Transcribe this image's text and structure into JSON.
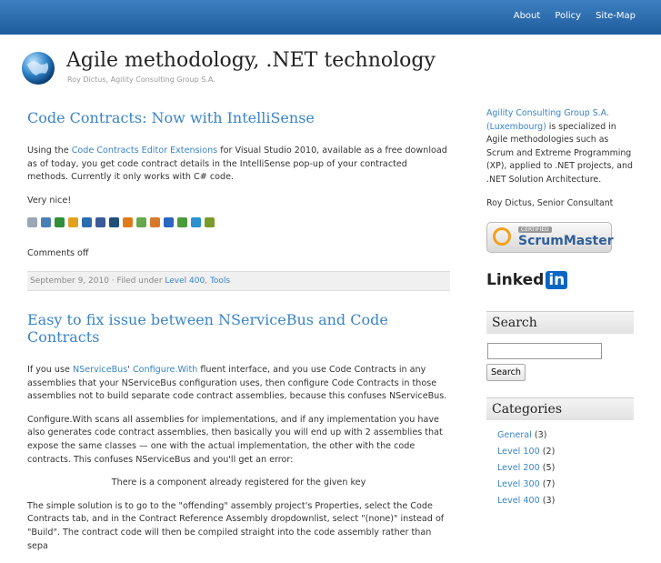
{
  "nav": [
    "About",
    "Policy",
    "Site-Map"
  ],
  "site": {
    "title": "Agile methodology, .NET technology",
    "subtitle": "Roy Dictus, Agility Consulting Group S.A."
  },
  "posts": [
    {
      "title": "Code Contracts: Now with IntelliSense",
      "p1_pre": "Using the ",
      "p1_link": "Code Contracts Editor Extensions",
      "p1_post": " for Visual Studio 2010, available as a free download as of today, you get code contract details in the IntelliSense pop-up of your contracted methods. Currently it only works with C# code.",
      "p2": "Very nice!",
      "comments": "Comments off",
      "date": "September 9, 2010",
      "filed": " · Filed under ",
      "cat1": "Level 400",
      "sep": ", ",
      "cat2": "Tools"
    },
    {
      "title": "Easy to fix issue between NServiceBus and Code Contracts",
      "p1_pre": "If you use ",
      "p1_link1": "NServiceBus",
      "p1_mid": "' ",
      "p1_link2": "Configure.With",
      "p1_post": " fluent interface, and you use Code Contracts in any assemblies that your NServiceBus configuration uses, then configure Code Contracts in those assemblies not to build separate code contract assemblies, because this confuses NServiceBus.",
      "p2": "Configure.With scans all assemblies for implementations, and if any implementation you have also generates code contract assemblies, then basically you will end up with 2 assemblies that expose the same classes — one with the actual implementation, the other with the code contracts. This confuses NServiceBus and you'll get an error:",
      "p3": "There is a component already registered for the given key",
      "p4": "The simple solution is to go to the \"offending\" assembly project's Properties, select the Code Contracts tab, and in the Contract Reference Assembly dropdownlist, select \"(none)\" instead of \"Build\". The contract code will then be compiled straight into the code assembly rather than sepa"
    }
  ],
  "sidebar": {
    "about_link": "Agility Consulting Group S.A. (Luxembourg)",
    "about_text": " is specialized in Agile methodologies such as Scrum and Extreme Programming (XP), applied to .NET projects, and .NET Solution Architecture.",
    "author": "Roy Dictus, Senior Consultant",
    "badge_cert": "CERTIFIED",
    "badge_name": "ScrumMaster",
    "linkedin_a": "Linked",
    "linkedin_b": "in",
    "search_title": "Search",
    "search_button": "Search",
    "categories_title": "Categories",
    "categories": [
      {
        "name": "General",
        "count": " (3)"
      },
      {
        "name": "Level 100",
        "count": " (2)"
      },
      {
        "name": "Level 200",
        "count": " (5)"
      },
      {
        "name": "Level 300",
        "count": " (7)"
      },
      {
        "name": "Level 400",
        "count": " (3)"
      }
    ]
  },
  "share_colors": [
    "#9aa7b4",
    "#4a7fb5",
    "#2f8f3a",
    "#e3a11e",
    "#2b6cb0",
    "#3b5998",
    "#1f4e79",
    "#e07b1a",
    "#6aa84f",
    "#d97a2b",
    "#2a66c2",
    "#4a9b3a",
    "#2a90d0",
    "#7a9a2a"
  ]
}
